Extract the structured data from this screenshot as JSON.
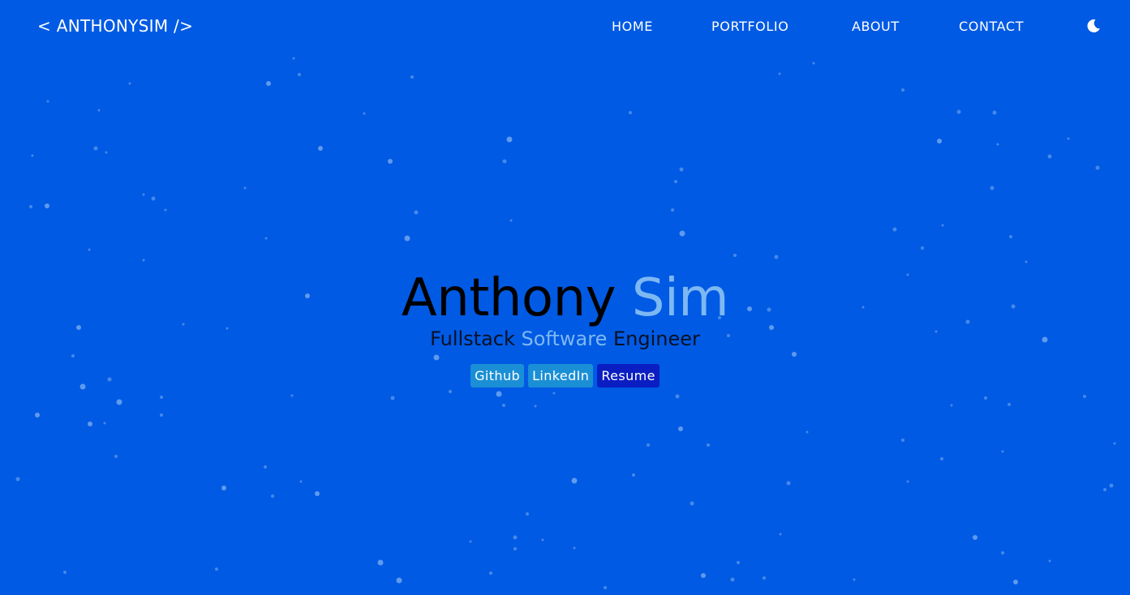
{
  "nav": {
    "brand": "< ANTHONYSIM />",
    "links": [
      {
        "label": "HOME"
      },
      {
        "label": "PORTFOLIO"
      },
      {
        "label": "ABOUT"
      },
      {
        "label": "CONTACT"
      }
    ],
    "theme_toggle_icon": "moon-icon"
  },
  "hero": {
    "first_name": "Anthony",
    "last_name": "Sim",
    "subtitle_part1": "Fullstack",
    "subtitle_part2": "Software",
    "subtitle_part3": "Engineer",
    "buttons": [
      {
        "label": "Github",
        "color": "#1a8fd6"
      },
      {
        "label": "LinkedIn",
        "color": "#1a8fd6"
      },
      {
        "label": "Resume",
        "color": "#0a1ec2"
      }
    ]
  },
  "colors": {
    "background": "#005ae4",
    "accent": "#7db8f3",
    "particle": "#7fb0f0"
  }
}
